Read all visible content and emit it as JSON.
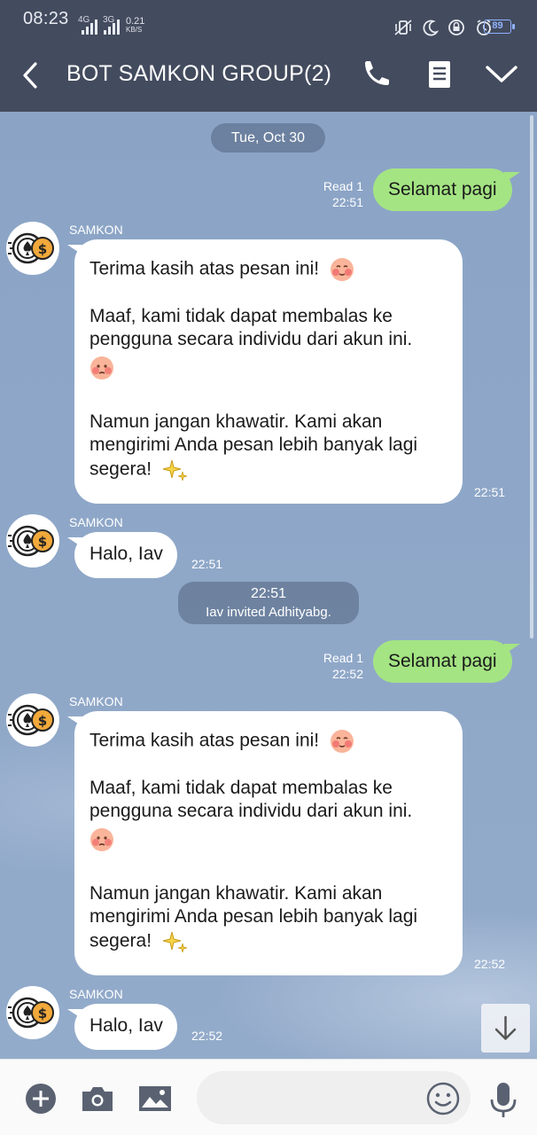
{
  "status_bar": {
    "time": "08:23",
    "net_1": "4G",
    "net_2": "3G",
    "speed_value": "0.21",
    "speed_unit": "KB/S",
    "battery": "89"
  },
  "header": {
    "title": "BOT SAMKON GROUP(2)",
    "icons": [
      "back-arrow-icon",
      "phone-icon",
      "notes-icon",
      "chevron-down-icon"
    ]
  },
  "chat": {
    "date_label": "Tue, Oct 30",
    "sent_1": {
      "text": "Selamat pagi",
      "read": "Read 1",
      "time": "22:51"
    },
    "recv_1": {
      "sender": "SAMKON",
      "para1": "Terima kasih atas pesan ini!",
      "para2": "Maaf, kami tidak dapat membalas ke pengguna secara individu dari akun ini.",
      "para3": "Namun jangan khawatir. Kami akan mengirimi Anda pesan lebih banyak lagi segera!",
      "time": "22:51"
    },
    "recv_2": {
      "sender": "SAMKON",
      "text": "Halo, Iav",
      "time": "22:51"
    },
    "system_1": {
      "time": "22:51",
      "text": "Iav invited Adhityabg."
    },
    "sent_2": {
      "text": "Selamat pagi",
      "read": "Read 1",
      "time": "22:52"
    },
    "recv_3": {
      "sender": "SAMKON",
      "para1": "Terima kasih atas pesan ini!",
      "para2": "Maaf, kami tidak dapat membalas ke pengguna secara individu dari akun ini.",
      "para3": "Namun jangan khawatir. Kami akan mengirimi Anda pesan lebih banyak lagi segera!",
      "time": "22:52"
    },
    "recv_4": {
      "sender": "SAMKON",
      "text": "Halo, Iav",
      "time": "22:52"
    }
  },
  "input_bar": {
    "placeholder": "",
    "icons": [
      "plus-icon",
      "camera-icon",
      "image-icon",
      "emoji-icon",
      "microphone-icon"
    ]
  },
  "colors": {
    "header_bg": "#434b5e",
    "chat_bg": "#8ea6c7",
    "sent_bubble": "#a4e483",
    "received_bubble": "#ffffff",
    "battery_accent": "#8fb3ff"
  }
}
